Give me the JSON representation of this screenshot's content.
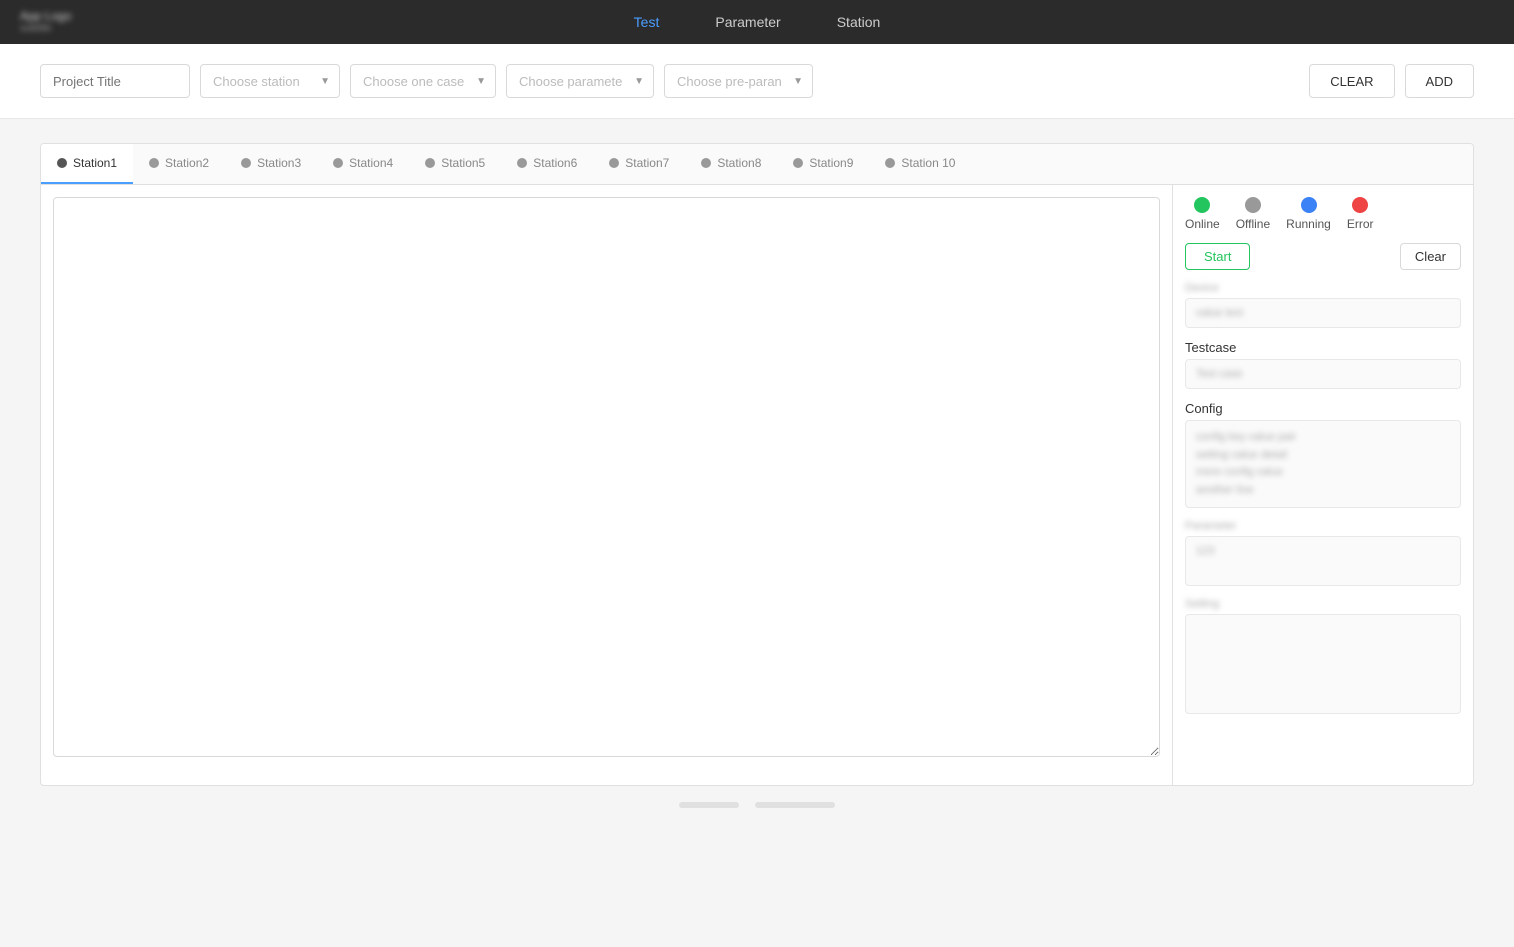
{
  "app": {
    "logo_line1": "App Logo",
    "logo_line2": "subtitle"
  },
  "nav": {
    "items": [
      {
        "id": "test",
        "label": "Test",
        "active": true
      },
      {
        "id": "parameter",
        "label": "Parameter",
        "active": false
      },
      {
        "id": "station",
        "label": "Station",
        "active": false
      }
    ]
  },
  "toolbar": {
    "project_placeholder": "Project Title",
    "station_placeholder": "Choose station",
    "case_placeholder": "Choose one case",
    "parameter_placeholder": "Choose paramete",
    "preparam_placeholder": "Choose pre-paran",
    "clear_label": "CLEAR",
    "add_label": "ADD"
  },
  "stations": [
    {
      "id": 1,
      "label": "Station1",
      "active": true
    },
    {
      "id": 2,
      "label": "Station2",
      "active": false
    },
    {
      "id": 3,
      "label": "Station3",
      "active": false
    },
    {
      "id": 4,
      "label": "Station4",
      "active": false
    },
    {
      "id": 5,
      "label": "Station5",
      "active": false
    },
    {
      "id": 6,
      "label": "Station6",
      "active": false
    },
    {
      "id": 7,
      "label": "Station7",
      "active": false
    },
    {
      "id": 8,
      "label": "Station8",
      "active": false
    },
    {
      "id": 9,
      "label": "Station9",
      "active": false
    },
    {
      "id": 10,
      "label": "Station 10",
      "active": false
    }
  ],
  "status": {
    "online_label": "Online",
    "offline_label": "Offline",
    "running_label": "Running",
    "error_label": "Error"
  },
  "controls": {
    "start_label": "Start",
    "clear_label": "Clear"
  },
  "info": {
    "device_label": "Device",
    "device_value": "",
    "testcase_label": "Testcase",
    "testcase_value": "",
    "config_label": "Config",
    "config_value": "",
    "parameter_label": "Parameter",
    "parameter_value": "",
    "second_label": "Setting",
    "second_value": ""
  }
}
